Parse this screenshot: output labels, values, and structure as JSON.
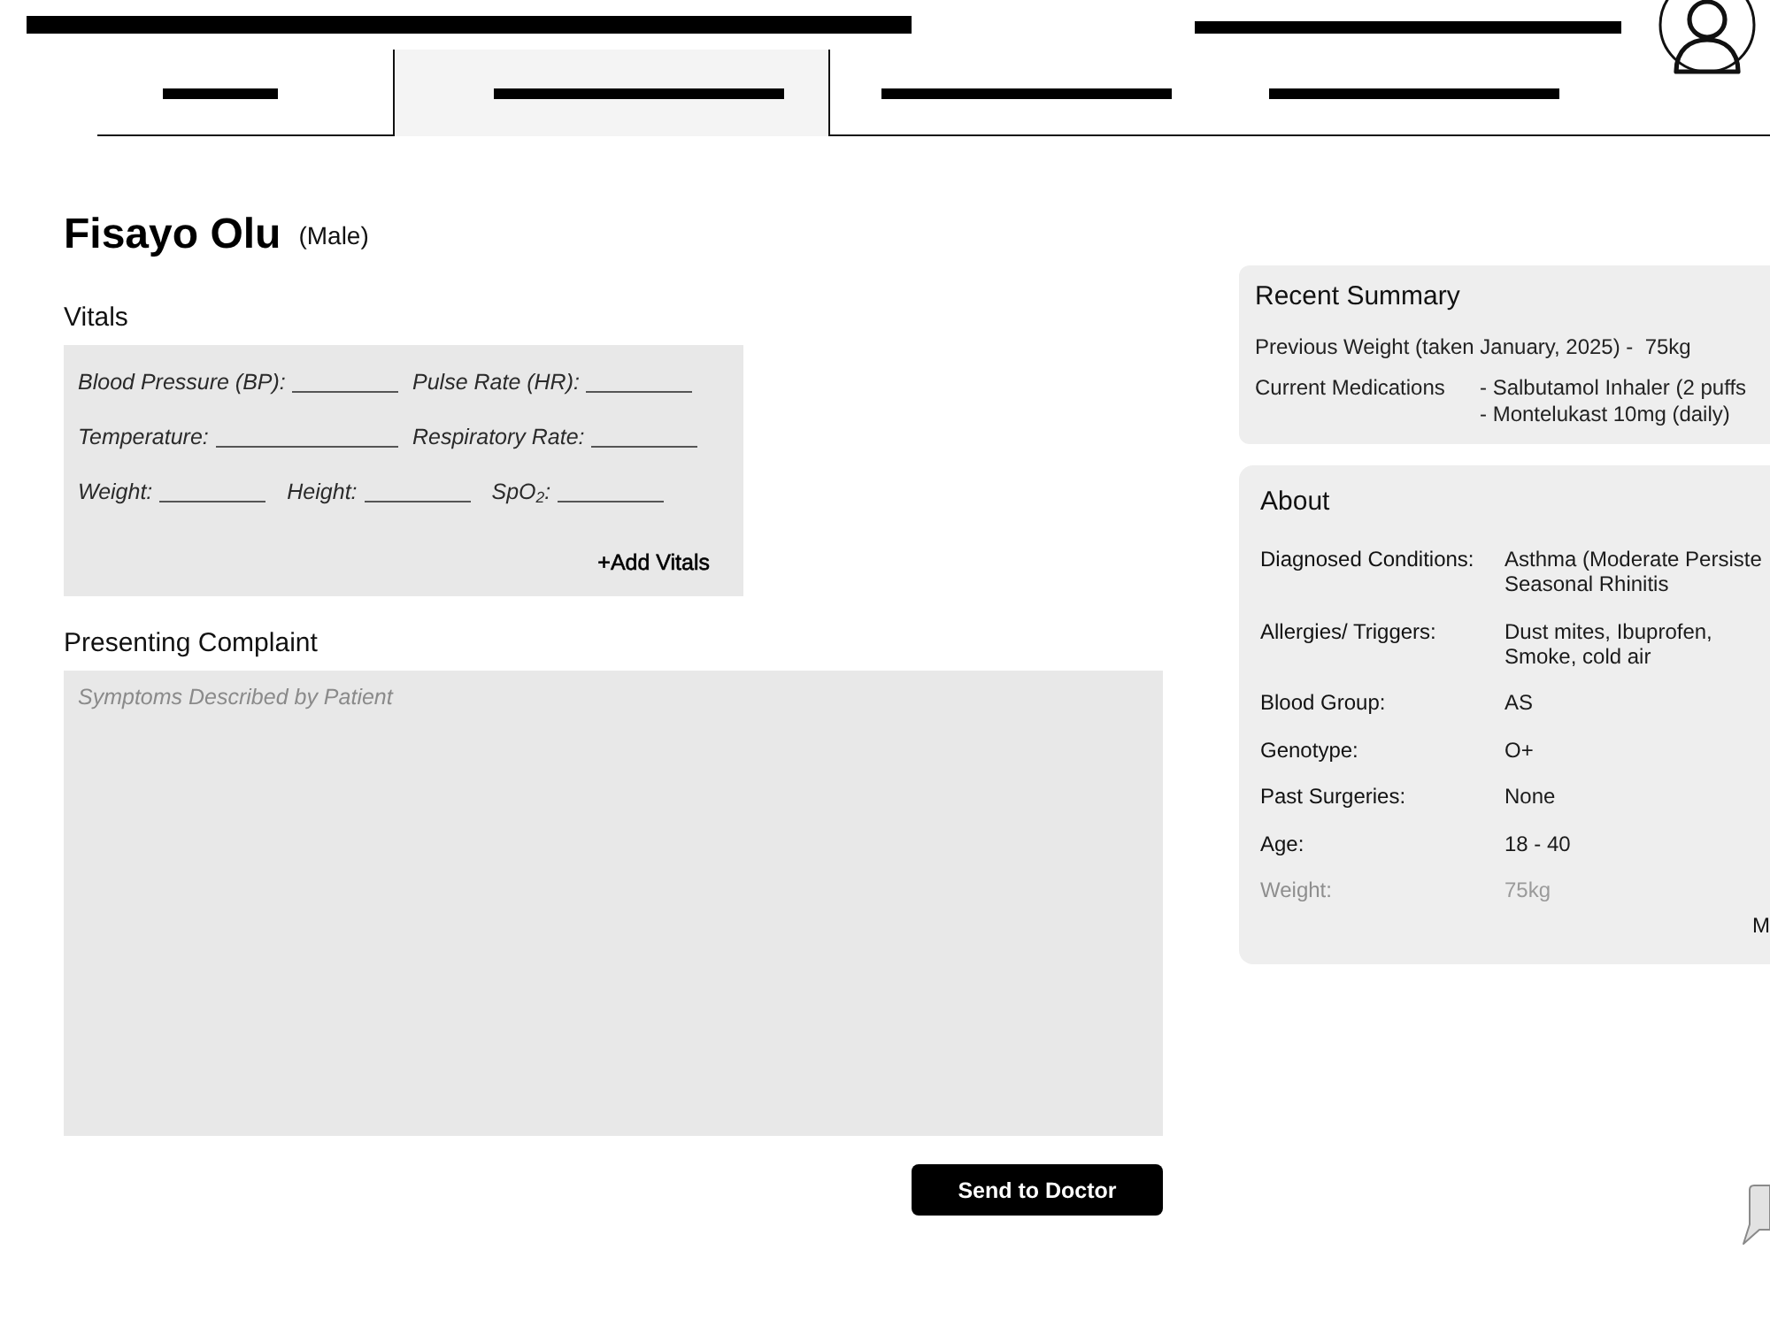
{
  "tabs": [
    {
      "selected": false
    },
    {
      "selected": true
    },
    {
      "selected": false
    },
    {
      "selected": false
    }
  ],
  "patient": {
    "name": "Fisayo Olu",
    "sex": "(Male)"
  },
  "vitals": {
    "title": "Vitals",
    "rows": [
      [
        {
          "label": "Blood Pressure (BP):"
        },
        {
          "label": "Pulse Rate (HR):"
        }
      ],
      [
        {
          "label": "Temperature:"
        },
        {
          "label": "Respiratory Rate:"
        }
      ],
      [
        {
          "label": "Weight:"
        },
        {
          "label": "Height:"
        },
        {
          "label": "SpO$_{2}$:"
        }
      ]
    ],
    "add_button": "+Add Vitals"
  },
  "complaint": {
    "title": "Presenting Complaint",
    "placeholder": "Symptoms Described by Patient"
  },
  "send_button": "Send to Doctor",
  "recent_summary": {
    "title": "Recent Summary",
    "previous_weight": "Previous Weight (taken January, 2025) -  75kg",
    "medications": {
      "label": "Current Medications",
      "lines": [
        "- Salbutamol Inhaler (2 puffs",
        "- Montelukast 10mg (daily)"
      ]
    }
  },
  "about": {
    "title": "About",
    "rows": [
      {
        "label": "Diagnosed Conditions:",
        "lines": [
          "Asthma (Moderate Persiste",
          "Seasonal Rhinitis"
        ],
        "faded": false
      },
      {
        "label": "Allergies/ Triggers:",
        "lines": [
          "Dust mites, Ibuprofen,",
          "Smoke, cold air"
        ],
        "faded": false
      },
      {
        "label": "Blood Group:",
        "lines": [
          "AS"
        ],
        "faded": false
      },
      {
        "label": "Genotype:",
        "lines": [
          "O+"
        ],
        "faded": false
      },
      {
        "label": "Past Surgeries:",
        "lines": [
          "None"
        ],
        "faded": false
      },
      {
        "label": "Age:",
        "lines": [
          "18 - 40"
        ],
        "faded": false
      },
      {
        "label": "Weight:",
        "lines": [
          "75kg"
        ],
        "faded": true
      }
    ],
    "trailing_text": "M"
  }
}
